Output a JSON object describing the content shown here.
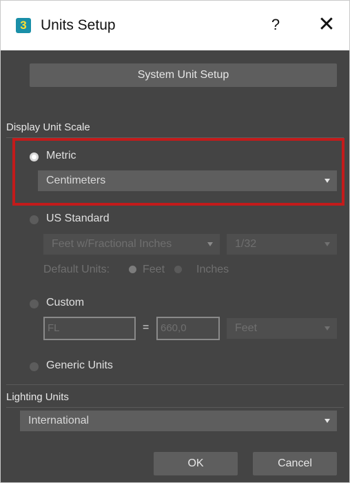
{
  "window": {
    "title": "Units Setup",
    "app_icon_text": "3",
    "help_label": "?",
    "close_label": "✕"
  },
  "system_unit_setup_label": "System Unit Setup",
  "display_unit_scale": {
    "section_label": "Display Unit Scale",
    "metric": {
      "label": "Metric",
      "selected": true,
      "dropdown_value": "Centimeters"
    },
    "us_standard": {
      "label": "US Standard",
      "dropdown_value": "Feet w/Fractional Inches",
      "fraction_value": "1/32",
      "default_units_label": "Default Units:",
      "feet_label": "Feet",
      "inches_label": "Inches"
    },
    "custom": {
      "label": "Custom",
      "name_value": "FL",
      "equals": "=",
      "amount_value": "660,0",
      "unit_value": "Feet"
    },
    "generic": {
      "label": "Generic Units"
    }
  },
  "lighting_units": {
    "section_label": "Lighting Units",
    "dropdown_value": "International"
  },
  "footer": {
    "ok_label": "OK",
    "cancel_label": "Cancel"
  },
  "colors": {
    "panel_bg": "#444444",
    "control_bg": "#5e5e5e",
    "highlight": "#c31b1b",
    "icon_bg": "#1a8fa8"
  }
}
